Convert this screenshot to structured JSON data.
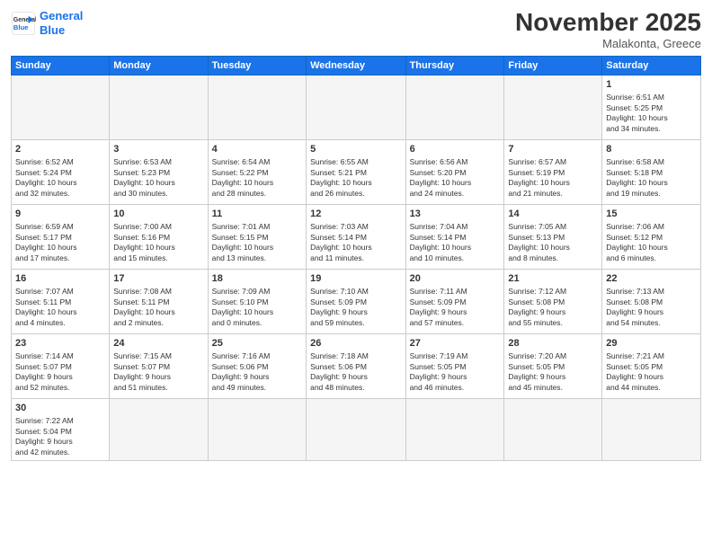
{
  "header": {
    "logo_general": "General",
    "logo_blue": "Blue",
    "month_title": "November 2025",
    "subtitle": "Malakonta, Greece"
  },
  "weekdays": [
    "Sunday",
    "Monday",
    "Tuesday",
    "Wednesday",
    "Thursday",
    "Friday",
    "Saturday"
  ],
  "weeks": [
    [
      {
        "day": "",
        "info": ""
      },
      {
        "day": "",
        "info": ""
      },
      {
        "day": "",
        "info": ""
      },
      {
        "day": "",
        "info": ""
      },
      {
        "day": "",
        "info": ""
      },
      {
        "day": "",
        "info": ""
      },
      {
        "day": "1",
        "info": "Sunrise: 6:51 AM\nSunset: 5:25 PM\nDaylight: 10 hours\nand 34 minutes."
      }
    ],
    [
      {
        "day": "2",
        "info": "Sunrise: 6:52 AM\nSunset: 5:24 PM\nDaylight: 10 hours\nand 32 minutes."
      },
      {
        "day": "3",
        "info": "Sunrise: 6:53 AM\nSunset: 5:23 PM\nDaylight: 10 hours\nand 30 minutes."
      },
      {
        "day": "4",
        "info": "Sunrise: 6:54 AM\nSunset: 5:22 PM\nDaylight: 10 hours\nand 28 minutes."
      },
      {
        "day": "5",
        "info": "Sunrise: 6:55 AM\nSunset: 5:21 PM\nDaylight: 10 hours\nand 26 minutes."
      },
      {
        "day": "6",
        "info": "Sunrise: 6:56 AM\nSunset: 5:20 PM\nDaylight: 10 hours\nand 24 minutes."
      },
      {
        "day": "7",
        "info": "Sunrise: 6:57 AM\nSunset: 5:19 PM\nDaylight: 10 hours\nand 21 minutes."
      },
      {
        "day": "8",
        "info": "Sunrise: 6:58 AM\nSunset: 5:18 PM\nDaylight: 10 hours\nand 19 minutes."
      }
    ],
    [
      {
        "day": "9",
        "info": "Sunrise: 6:59 AM\nSunset: 5:17 PM\nDaylight: 10 hours\nand 17 minutes."
      },
      {
        "day": "10",
        "info": "Sunrise: 7:00 AM\nSunset: 5:16 PM\nDaylight: 10 hours\nand 15 minutes."
      },
      {
        "day": "11",
        "info": "Sunrise: 7:01 AM\nSunset: 5:15 PM\nDaylight: 10 hours\nand 13 minutes."
      },
      {
        "day": "12",
        "info": "Sunrise: 7:03 AM\nSunset: 5:14 PM\nDaylight: 10 hours\nand 11 minutes."
      },
      {
        "day": "13",
        "info": "Sunrise: 7:04 AM\nSunset: 5:14 PM\nDaylight: 10 hours\nand 10 minutes."
      },
      {
        "day": "14",
        "info": "Sunrise: 7:05 AM\nSunset: 5:13 PM\nDaylight: 10 hours\nand 8 minutes."
      },
      {
        "day": "15",
        "info": "Sunrise: 7:06 AM\nSunset: 5:12 PM\nDaylight: 10 hours\nand 6 minutes."
      }
    ],
    [
      {
        "day": "16",
        "info": "Sunrise: 7:07 AM\nSunset: 5:11 PM\nDaylight: 10 hours\nand 4 minutes."
      },
      {
        "day": "17",
        "info": "Sunrise: 7:08 AM\nSunset: 5:11 PM\nDaylight: 10 hours\nand 2 minutes."
      },
      {
        "day": "18",
        "info": "Sunrise: 7:09 AM\nSunset: 5:10 PM\nDaylight: 10 hours\nand 0 minutes."
      },
      {
        "day": "19",
        "info": "Sunrise: 7:10 AM\nSunset: 5:09 PM\nDaylight: 9 hours\nand 59 minutes."
      },
      {
        "day": "20",
        "info": "Sunrise: 7:11 AM\nSunset: 5:09 PM\nDaylight: 9 hours\nand 57 minutes."
      },
      {
        "day": "21",
        "info": "Sunrise: 7:12 AM\nSunset: 5:08 PM\nDaylight: 9 hours\nand 55 minutes."
      },
      {
        "day": "22",
        "info": "Sunrise: 7:13 AM\nSunset: 5:08 PM\nDaylight: 9 hours\nand 54 minutes."
      }
    ],
    [
      {
        "day": "23",
        "info": "Sunrise: 7:14 AM\nSunset: 5:07 PM\nDaylight: 9 hours\nand 52 minutes."
      },
      {
        "day": "24",
        "info": "Sunrise: 7:15 AM\nSunset: 5:07 PM\nDaylight: 9 hours\nand 51 minutes."
      },
      {
        "day": "25",
        "info": "Sunrise: 7:16 AM\nSunset: 5:06 PM\nDaylight: 9 hours\nand 49 minutes."
      },
      {
        "day": "26",
        "info": "Sunrise: 7:18 AM\nSunset: 5:06 PM\nDaylight: 9 hours\nand 48 minutes."
      },
      {
        "day": "27",
        "info": "Sunrise: 7:19 AM\nSunset: 5:05 PM\nDaylight: 9 hours\nand 46 minutes."
      },
      {
        "day": "28",
        "info": "Sunrise: 7:20 AM\nSunset: 5:05 PM\nDaylight: 9 hours\nand 45 minutes."
      },
      {
        "day": "29",
        "info": "Sunrise: 7:21 AM\nSunset: 5:05 PM\nDaylight: 9 hours\nand 44 minutes."
      }
    ],
    [
      {
        "day": "30",
        "info": "Sunrise: 7:22 AM\nSunset: 5:04 PM\nDaylight: 9 hours\nand 42 minutes."
      },
      {
        "day": "",
        "info": ""
      },
      {
        "day": "",
        "info": ""
      },
      {
        "day": "",
        "info": ""
      },
      {
        "day": "",
        "info": ""
      },
      {
        "day": "",
        "info": ""
      },
      {
        "day": "",
        "info": ""
      }
    ]
  ]
}
